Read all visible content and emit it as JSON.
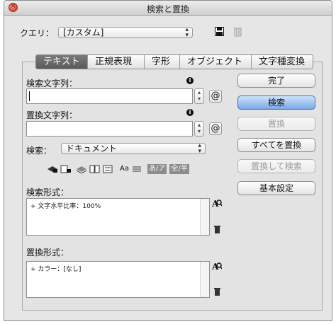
{
  "window": {
    "title": "検索と置換"
  },
  "query": {
    "label": "クエリ：",
    "value": "[カスタム]"
  },
  "tabs": [
    "テキスト",
    "正規表現",
    "字形",
    "オブジェクト",
    "文字種変換"
  ],
  "find": {
    "label": "検索文字列：",
    "value": "",
    "at_label": "@"
  },
  "change": {
    "label": "置換文字列：",
    "value": "",
    "at_label": "@"
  },
  "search": {
    "label": "検索：",
    "value": "ドキュメント"
  },
  "options": {
    "case_label": "Aa",
    "kana_label": "あ/ア",
    "width_label": "全/半"
  },
  "find_format": {
    "label": "検索形式：",
    "value": "+ 文字水平比率：100%"
  },
  "change_format": {
    "label": "置換形式：",
    "value": "+ カラー：[なし]"
  },
  "buttons": {
    "done": "完了",
    "find": "検索",
    "change": "置換",
    "change_all": "すべてを置換",
    "change_find": "置換して検索",
    "fewer_options": "基本設定"
  },
  "colors": {
    "primary_button": "#7aa9e6",
    "active_tab": "#5a5a5a"
  }
}
